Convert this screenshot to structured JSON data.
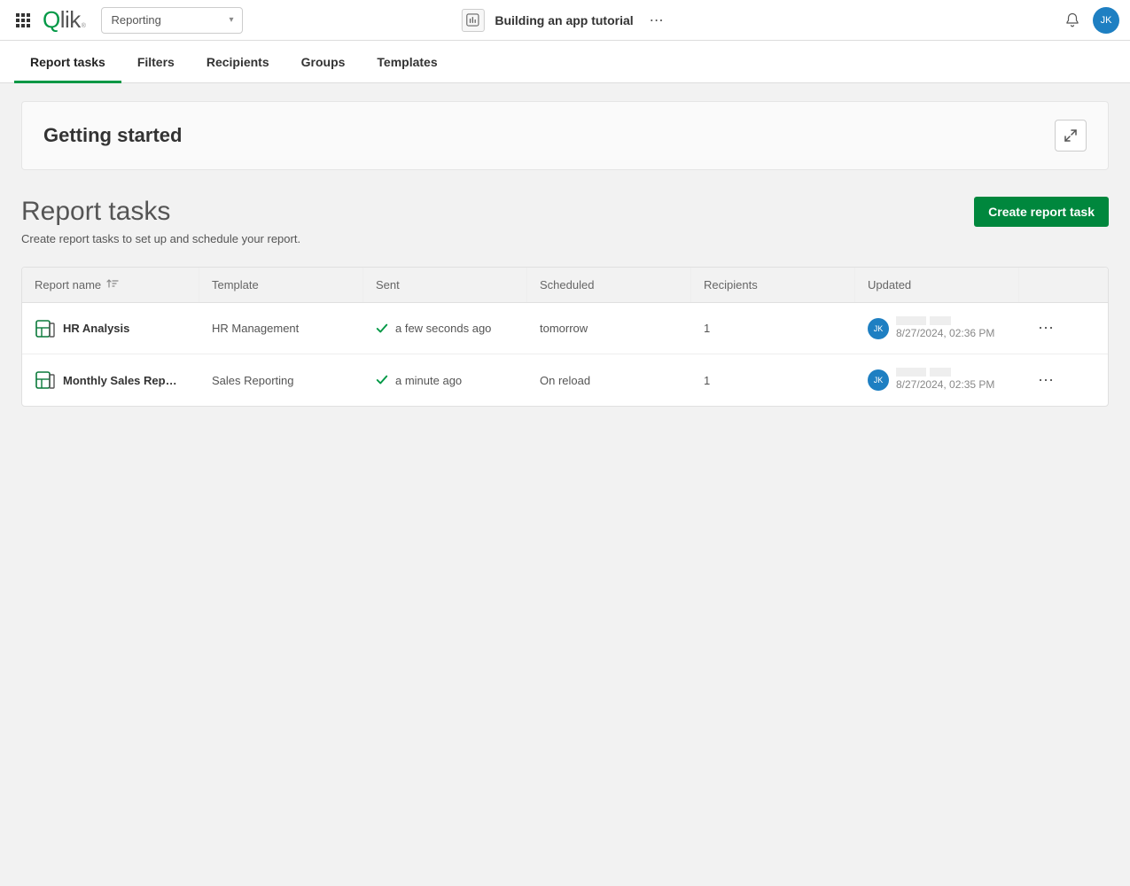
{
  "header": {
    "section": "Reporting",
    "app_title": "Building an app tutorial",
    "user_initials": "JK"
  },
  "tabs": [
    {
      "label": "Report tasks",
      "active": true
    },
    {
      "label": "Filters"
    },
    {
      "label": "Recipients"
    },
    {
      "label": "Groups"
    },
    {
      "label": "Templates"
    }
  ],
  "getting_started": {
    "title": "Getting started"
  },
  "page": {
    "title": "Report tasks",
    "subtitle": "Create report tasks to set up and schedule your report.",
    "create_btn": "Create report task"
  },
  "table": {
    "columns": [
      "Report name",
      "Template",
      "Sent",
      "Scheduled",
      "Recipients",
      "Updated"
    ],
    "rows": [
      {
        "name": "HR Analysis",
        "template": "HR Management",
        "sent": "a few seconds ago",
        "scheduled": "tomorrow",
        "recipients": "1",
        "updated_by": "JK",
        "updated_at": "8/27/2024, 02:36 PM"
      },
      {
        "name": "Monthly Sales Rep…",
        "template": "Sales Reporting",
        "sent": "a minute ago",
        "scheduled": "On reload",
        "recipients": "1",
        "updated_by": "JK",
        "updated_at": "8/27/2024, 02:35 PM"
      }
    ]
  }
}
